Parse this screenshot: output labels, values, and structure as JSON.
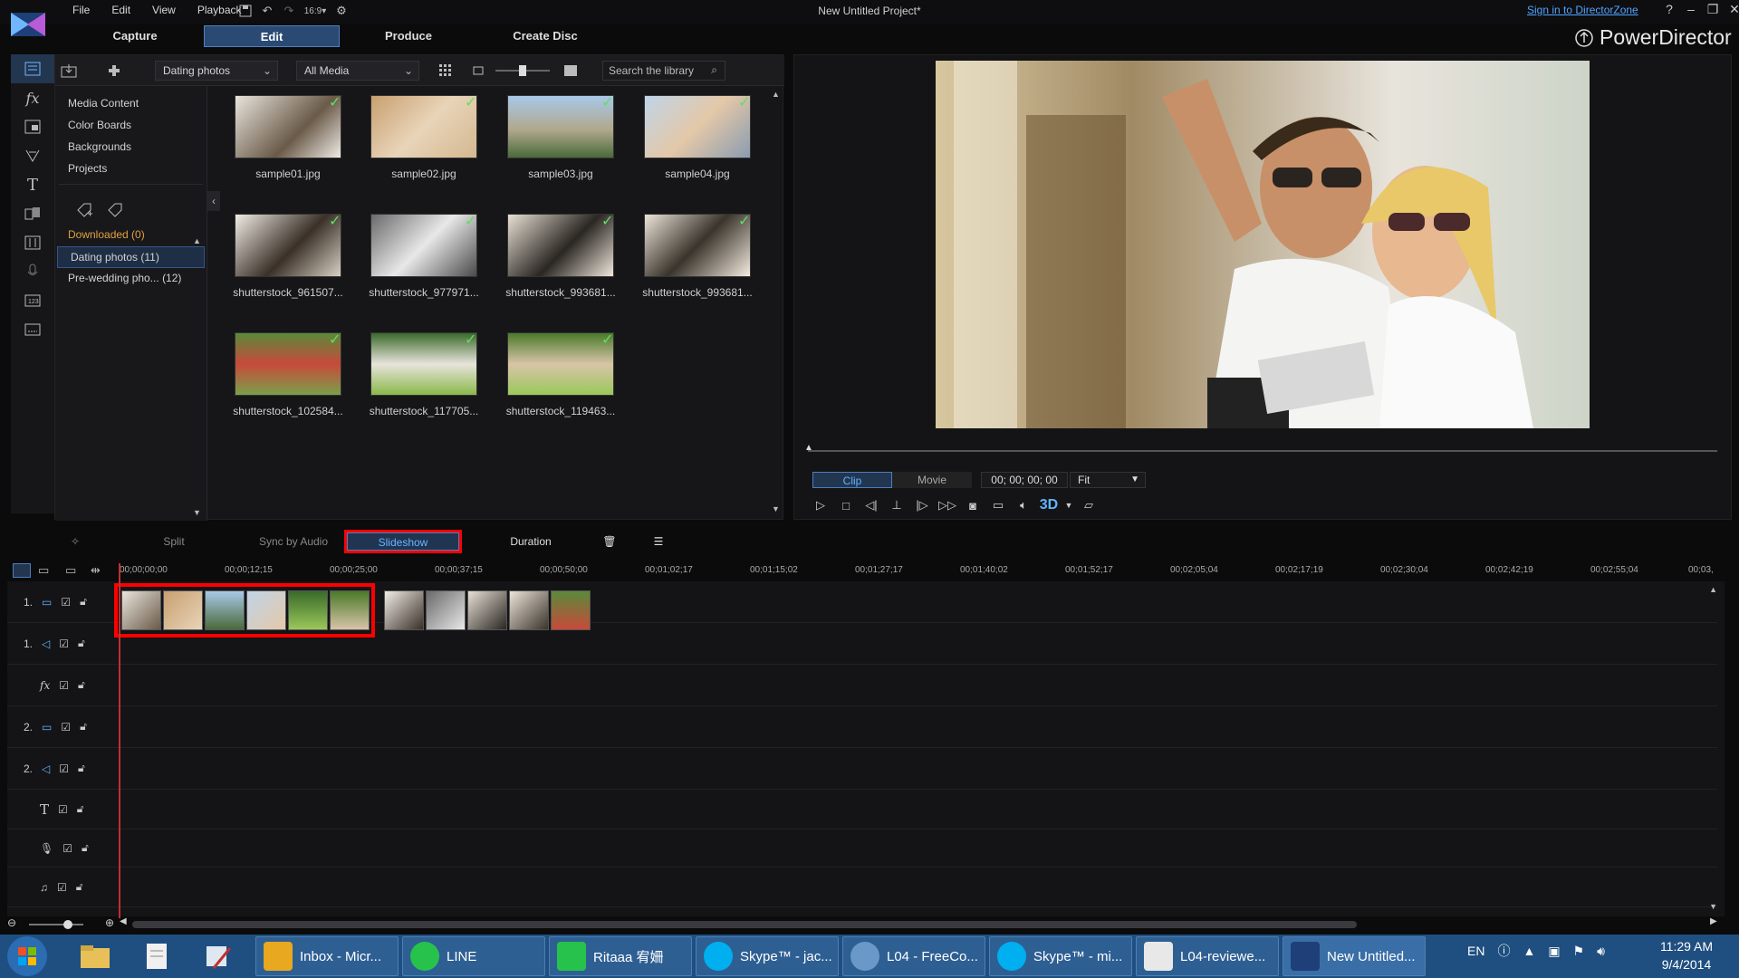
{
  "window": {
    "title": "New Untitled Project*",
    "signin": "Sign in to DirectorZone"
  },
  "menu": [
    "File",
    "Edit",
    "View",
    "Playback"
  ],
  "mode_tabs": [
    "Capture",
    "Edit",
    "Produce",
    "Create Disc"
  ],
  "brand": "PowerDirector",
  "library": {
    "folder_select": "Dating photos",
    "media_filter": "All Media",
    "search_placeholder": "Search the library",
    "tree": [
      "Media Content",
      "Color Boards",
      "Backgrounds",
      "Projects"
    ],
    "tags": {
      "downloaded": "Downloaded  (0)",
      "dating": "Dating photos  (11)",
      "prewedding": "Pre-wedding pho...  (12)"
    },
    "items": [
      "sample01.jpg",
      "sample02.jpg",
      "sample03.jpg",
      "sample04.jpg",
      "shutterstock_961507...",
      "shutterstock_977971...",
      "shutterstock_993681...",
      "shutterstock_993681...",
      "shutterstock_102584...",
      "shutterstock_117705...",
      "shutterstock_119463..."
    ]
  },
  "preview": {
    "clip": "Clip",
    "movie": "Movie",
    "timecode": "00; 00; 00; 00",
    "fit": "Fit",
    "threed": "3D"
  },
  "midbar": {
    "split": "Split",
    "sync": "Sync by Audio",
    "slideshow": "Slideshow",
    "duration": "Duration"
  },
  "ruler": [
    "00;00;00;00",
    "00;00;12;15",
    "00;00;25;00",
    "00;00;37;15",
    "00;00;50;00",
    "00;01;02;17",
    "00;01;15;02",
    "00;01;27;17",
    "00;01;40;02",
    "00;01;52;17",
    "00;02;05;04",
    "00;02;17;19",
    "00;02;30;04",
    "00;02;42;19",
    "00;02;55;04",
    "00;03,"
  ],
  "tracks": [
    "1.",
    "1.",
    "",
    "2.",
    "2.",
    "",
    "",
    ""
  ],
  "taskbar": {
    "apps": [
      "Inbox - Micr...",
      "LINE",
      "Ritaaa 宥姍",
      "Skype™ - jac...",
      "L04 - FreeCo...",
      "Skype™ - mi...",
      "L04-reviewe...",
      "New Untitled..."
    ],
    "lang": "EN",
    "time": "11:29 AM",
    "date": "9/4/2014"
  }
}
